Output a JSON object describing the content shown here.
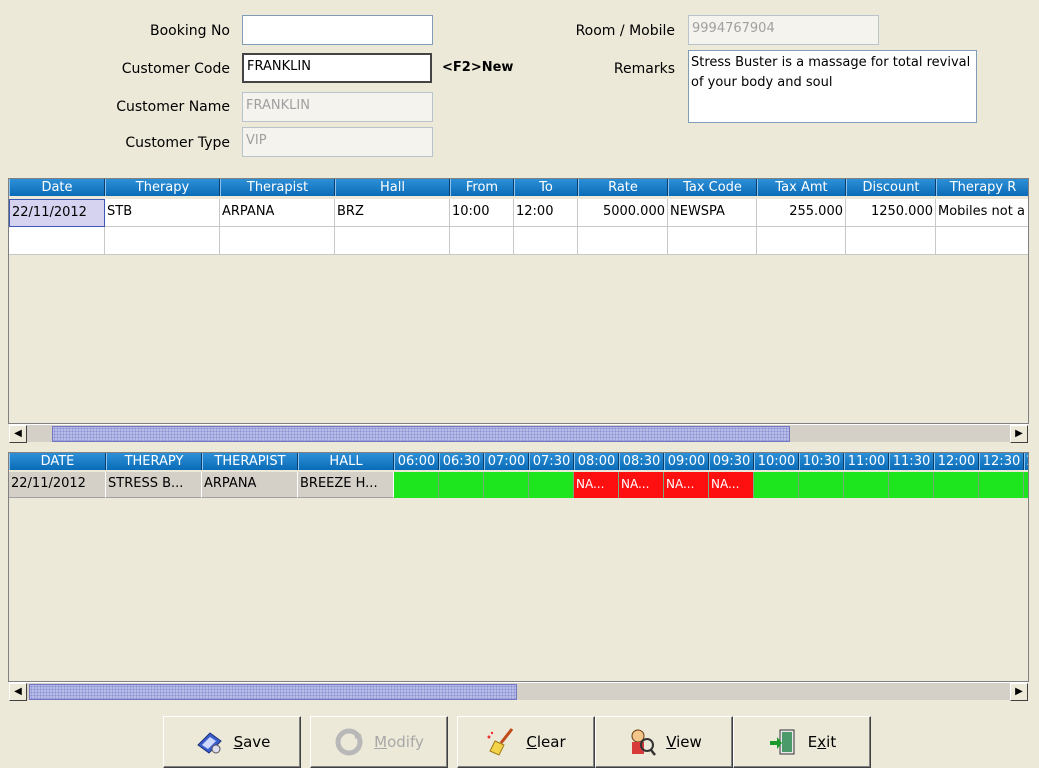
{
  "form": {
    "booking_no": {
      "label": "Booking No",
      "value": ""
    },
    "customer_code": {
      "label": "Customer Code",
      "value": "FRANKLIN",
      "hint": "<F2>New"
    },
    "customer_name": {
      "label": "Customer Name",
      "value": "FRANKLIN"
    },
    "customer_type": {
      "label": "Customer Type",
      "value": "VIP"
    },
    "room_mobile": {
      "label": "Room / Mobile",
      "value": "9994767904"
    },
    "remarks": {
      "label": "Remarks",
      "value": "Stress Buster is a massage for total revival of your body and soul"
    }
  },
  "booking_grid": {
    "headers": [
      "Date",
      "Therapy",
      "Therapist",
      "Hall",
      "From",
      "To",
      "Rate",
      "Tax Code",
      "Tax Amt",
      "Discount",
      "Therapy R"
    ],
    "rows": [
      [
        "22/11/2012",
        "STB",
        "ARPANA",
        "BRZ",
        "10:00",
        "12:00",
        "5000.000",
        "NEWSPA",
        "255.000",
        "1250.000",
        "Mobiles not a"
      ]
    ]
  },
  "schedule_grid": {
    "headers": [
      "DATE",
      "THERAPY",
      "THERAPIST",
      "HALL"
    ],
    "time_headers": [
      "06:00",
      "06:30",
      "07:00",
      "07:30",
      "08:00",
      "08:30",
      "09:00",
      "09:30",
      "10:00",
      "10:30",
      "11:00",
      "11:30",
      "12:00",
      "12:30",
      "1"
    ],
    "rows": [
      {
        "cells": [
          "22/11/2012",
          "STRESS B...",
          "ARPANA",
          "BREEZE H..."
        ],
        "slots": [
          {
            "status": "free",
            "text": ""
          },
          {
            "status": "free",
            "text": ""
          },
          {
            "status": "free",
            "text": ""
          },
          {
            "status": "free",
            "text": ""
          },
          {
            "status": "busy",
            "text": "NA..."
          },
          {
            "status": "busy",
            "text": "NA..."
          },
          {
            "status": "busy",
            "text": "NA..."
          },
          {
            "status": "busy",
            "text": "NA..."
          },
          {
            "status": "free",
            "text": ""
          },
          {
            "status": "free",
            "text": ""
          },
          {
            "status": "free",
            "text": ""
          },
          {
            "status": "free",
            "text": ""
          },
          {
            "status": "free",
            "text": ""
          },
          {
            "status": "free",
            "text": ""
          },
          {
            "status": "free",
            "text": ""
          }
        ]
      }
    ]
  },
  "buttons": {
    "save": {
      "label_u": "S",
      "label_rest": "ave",
      "icon": "save-icon"
    },
    "modify": {
      "label_u": "M",
      "label_rest": "odify",
      "icon": "modify-icon"
    },
    "clear": {
      "label_u": "C",
      "label_rest": "lear",
      "icon": "broom-icon"
    },
    "view": {
      "label_u": "V",
      "label_rest": "iew",
      "icon": "view-icon"
    },
    "exit": {
      "label_pre": "E",
      "label_u": "x",
      "label_rest": "it",
      "icon": "exit-door-icon"
    }
  },
  "colors": {
    "free": "#1ee61e",
    "busy": "#ff1010",
    "header": "#0a6cb8"
  }
}
